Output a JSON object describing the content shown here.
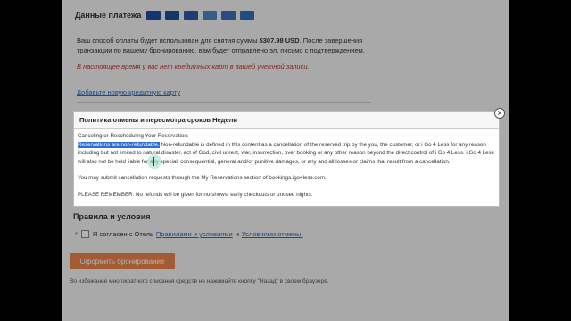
{
  "payment": {
    "title": "Данные платежа",
    "cards": [
      {
        "icon": "visa-card-icon",
        "color": "#1a4fa0"
      },
      {
        "icon": "visa-card-icon",
        "color": "#1a4fa0"
      },
      {
        "icon": "mastercard-icon",
        "color": "#2a5aa8"
      },
      {
        "icon": "amex-card-icon",
        "color": "#4a86c8"
      },
      {
        "icon": "jcb-card-icon",
        "color": "#3b6fb6"
      },
      {
        "icon": "diners-card-icon",
        "color": "#2f6db5"
      }
    ],
    "info_line1_pre": "Ваш способ оплаты будет использован для снятия суммы ",
    "info_amount": "$307.98 USD",
    "info_line1_post": ". После завершения транзакции по вашему бронированию, вам будет отправлено эл. письмо с подтверждением.",
    "warning": "В настоящее время у вас нет кредитных карт в вашей учетной записи.",
    "add_card_link": "Добавьте новую кредитную карту"
  },
  "modal": {
    "title": "Политика отмены и пересмотра сроков Недели",
    "subheading": "Canceling or Rescheduling Your Reservation:",
    "highlighted": "Reservations are non-refundable.",
    "para1": " Non-refundable is defined in this content as a cancellation of the reserved trip by the you, the customer, or i Go 4 Less for any reason including but not limited to natural disaster, act of God, civil unrest, war, insurrection, over booking or any other reason beyond the direct control of i Go 4 Less. i Go 4 Less will also not be held liable for any special, consequential, general and/or punitive damages, or any and all losses or claims that result from a cancellation.",
    "para2": "You may submit cancellation requests through the My Reservations section of bookings.igo4less.com.",
    "para3": "PLEASE REMEMBER: No refunds will be given for no-shows, early checkouts or unused nights.",
    "close_symbol": "×"
  },
  "terms": {
    "title": "Правила и условия",
    "asterisk": "*",
    "agree_pre": "Я согласен с Отель",
    "rules_link": "Правилами и условиями",
    "and": "и",
    "cancel_link": "Условиями отмены."
  },
  "book_button": "Оформить бронирование",
  "footer_note": "Во избежание многократного списания средств не нажимайте кнопку \"Назад\" в своем браузере."
}
